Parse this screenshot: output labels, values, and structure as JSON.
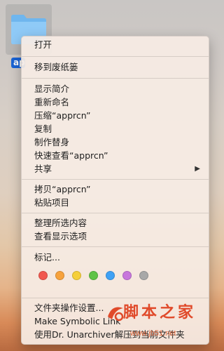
{
  "desktop": {
    "folder_label": "apprcn"
  },
  "menu": {
    "open": "打开",
    "trash": "移到废纸篓",
    "get_info": "显示简介",
    "rename": "重新命名",
    "compress": "压缩“apprcn”",
    "duplicate": "复制",
    "make_alias": "制作替身",
    "quick_look": "快速查看“apprcn”",
    "share": "共享",
    "share_arrow": "▶",
    "copy": "拷贝“apprcn”",
    "paste": "粘贴项目",
    "clean_up": "整理所选内容",
    "view_options": "查看显示选项",
    "tags": "标记...",
    "folder_actions": "文件夹操作设置...",
    "make_symlink": "Make Symbolic Link",
    "unarchiver": "使用Dr. Unarchiver解压到当前文件夹"
  },
  "tag_colors": [
    {
      "name": "red",
      "color": "#f1584f"
    },
    {
      "name": "orange",
      "color": "#f7a23c"
    },
    {
      "name": "yellow",
      "color": "#f5cf3a"
    },
    {
      "name": "green",
      "color": "#5fc346"
    },
    {
      "name": "blue",
      "color": "#3fa1f5"
    },
    {
      "name": "purple",
      "color": "#c776dc"
    },
    {
      "name": "gray",
      "color": "#a8a8a8"
    }
  ],
  "watermark": {
    "title": "脚本之家",
    "url": "www.jb51.net"
  }
}
